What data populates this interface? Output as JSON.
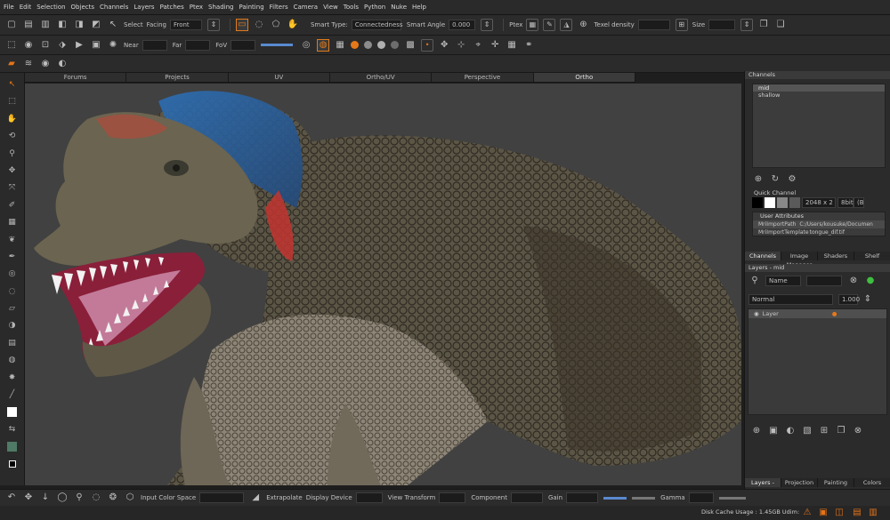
{
  "menu": [
    "File",
    "Edit",
    "Selection",
    "Objects",
    "Channels",
    "Layers",
    "Patches",
    "Ptex",
    "Shading",
    "Painting",
    "Filters",
    "Camera",
    "View",
    "Tools",
    "Python",
    "Nuke",
    "Help"
  ],
  "toolbar1": {
    "select_label": "Select",
    "facing_label": "Facing",
    "facing_value": "Front",
    "smart_type_label": "Smart Type:",
    "smart_type_value": "Connectedness",
    "smart_angle_label": "Smart Angle",
    "smart_angle_value": "0.000",
    "ptex_label": "Ptex",
    "texel_density_label": "Texel density",
    "size_label": "Size"
  },
  "toolbar2": {
    "near_label": "Near",
    "far_label": "Far",
    "fov_label": "FoV"
  },
  "view_tabs": [
    "Forums",
    "Projects",
    "UV",
    "Ortho/UV",
    "Perspective",
    "Ortho"
  ],
  "active_view_tab": "Ortho",
  "channels_panel": {
    "title": "Channels",
    "items": [
      "mid",
      "shallow"
    ],
    "quick_channel_label": "Quick Channel",
    "resolution": "2048 x 2",
    "bit_depth": "8bit",
    "bit_suffix": "(B",
    "user_attributes_label": "User Attributes",
    "attributes": [
      {
        "key": "MriImportPath",
        "value": "C:/Users/kousuke/Documen"
      },
      {
        "key": "MriImportTemplate",
        "value": "tongue_dif.tif"
      }
    ]
  },
  "panel_tabs_top": [
    "Channels",
    "Image Manager",
    "Shaders",
    "Shelf"
  ],
  "layers_panel": {
    "title": "Layers - mid",
    "filter_value": "Name",
    "blend_mode": "Normal",
    "opacity": "1.000",
    "layer_name": "Layer"
  },
  "panel_tabs_bottom": [
    "Layers - mid",
    "Projection",
    "Painting",
    "Colors"
  ],
  "statusbar": {
    "input_color_space_label": "Input Color Space",
    "extrapolate_label": "Extrapolate",
    "display_device_label": "Display Device",
    "view_transform_label": "View Transform",
    "component_label": "Component",
    "gain_label": "Gain",
    "gamma_label": "Gamma"
  },
  "disk_cache": "Disk Cache Usage : 1.45GB Udim:"
}
